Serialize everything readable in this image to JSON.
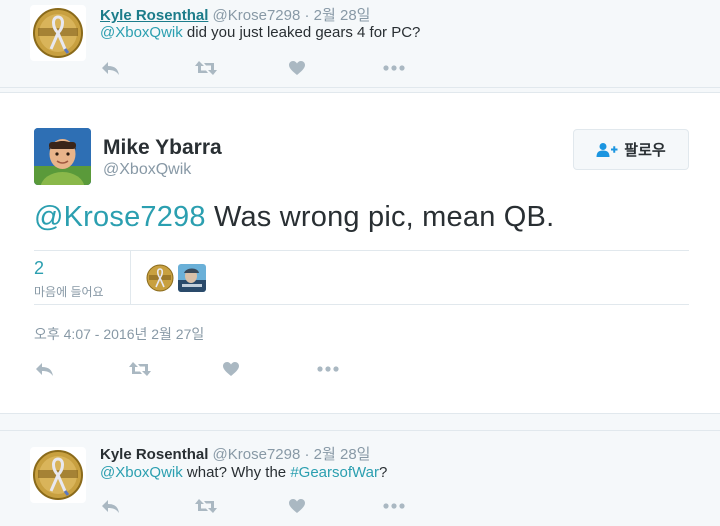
{
  "reply_top": {
    "fullname": "Kyle Rosenthal",
    "handle": "@Krose7298",
    "sep": "·",
    "date": "2월 28일",
    "mention": "@XboxQwik",
    "text": " did you just leaked gears 4 for PC?"
  },
  "main_tweet": {
    "fullname": "Mike Ybarra",
    "handle": "@XboxQwik",
    "follow_label": "팔로우",
    "mention": "@Krose7298",
    "text": " Was wrong pic, mean QB.",
    "likes_count": "2",
    "likes_label": "마음에 들어요",
    "timestamp": "오후 4:07 - 2016년 2월 27일"
  },
  "reply_bottom": {
    "fullname": "Kyle Rosenthal",
    "handle": "@Krose7298",
    "sep": "·",
    "date": "2월 28일",
    "mention": "@XboxQwik",
    "text_mid": " what? Why the ",
    "hashtag": "#GearsofWar",
    "text_end": "?"
  },
  "colors": {
    "link": "#2b9fb0",
    "muted": "#8899a6",
    "text": "#292f33",
    "icon": "#aab8c2"
  },
  "icons": [
    "reply-icon",
    "retweet-icon",
    "like-icon",
    "more-icon",
    "follow-person-icon"
  ]
}
